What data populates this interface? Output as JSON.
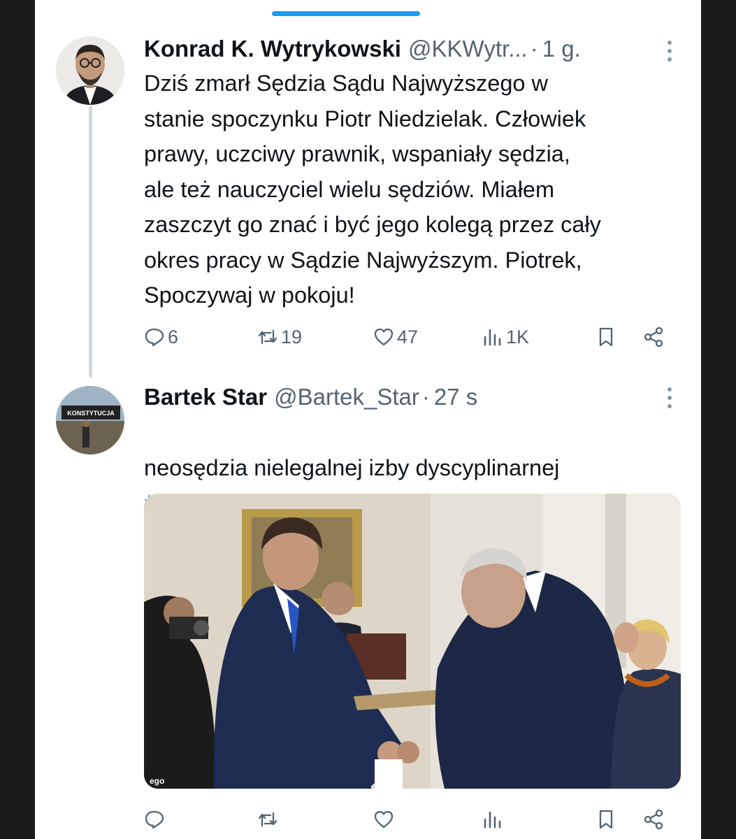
{
  "tweet1": {
    "author_name": "Konrad K. Wytrykowski",
    "author_handle": "@KKWytr...",
    "separator": "·",
    "timestamp": "1 g.",
    "text": "Dziś zmarł Sędzia Sądu Najwyższego w\nstanie spoczynku Piotr Niedzielak. Człowiek\nprawy, uczciwy prawnik, wspaniały sędzia,\nale też nauczyciel wielu sędziów. Miałem\nzaszczyt go znać i być jego kolegą przez cały\nokres pracy w Sądzie Najwyższym. Piotrek,\nSpoczywaj w pokoju!",
    "reply_count": "6",
    "retweet_count": "19",
    "like_count": "47",
    "view_count": "1K"
  },
  "tweet2": {
    "author_name": "Bartek Star",
    "author_handle": "@Bartek_Star",
    "separator": "·",
    "timestamp": "27 s",
    "text": "neosędzia nielegalnej izby dyscyplinarnej",
    "hashtag": "#pamiętamy",
    "media_watermark": "ego",
    "avatar_banner_text": "KONSTYTUCJA"
  },
  "icons": [
    "reply-icon",
    "retweet-icon",
    "like-icon",
    "views-icon",
    "bookmark-icon",
    "share-icon",
    "more-icon"
  ],
  "colors": {
    "accent": "#1d9bf0",
    "text_primary": "#0f1419",
    "text_secondary": "#536471",
    "thread_line": "#cfd9de"
  }
}
